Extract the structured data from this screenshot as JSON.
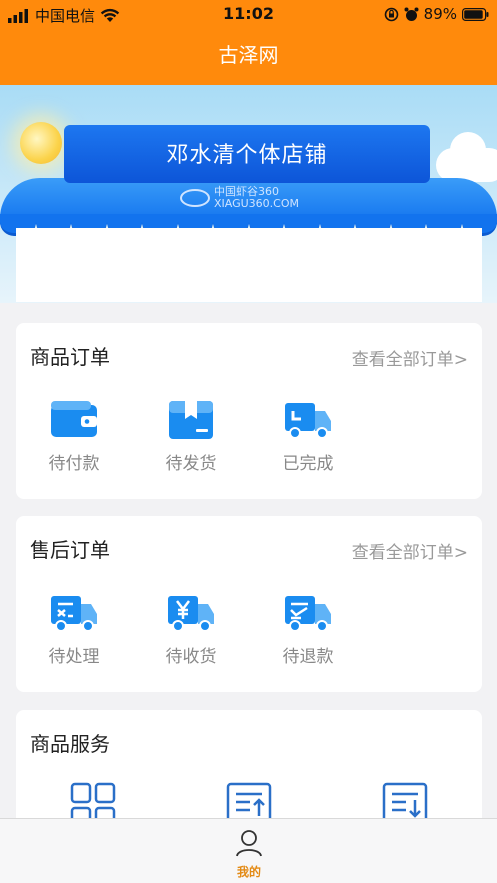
{
  "status_bar": {
    "carrier": "中国电信",
    "time": "11:02",
    "battery": "89%"
  },
  "nav": {
    "title": "古泽网"
  },
  "shop": {
    "name": "邓水清个体店铺",
    "awning_logo_cn": "中国虾谷360",
    "awning_logo_en": "XIAGU360.COM"
  },
  "orders": {
    "title": "商品订单",
    "view_all": "查看全部订单>",
    "items": [
      {
        "label": "待付款",
        "icon": "wallet-icon"
      },
      {
        "label": "待发货",
        "icon": "package-icon"
      },
      {
        "label": "已完成",
        "icon": "delivery-truck-icon"
      }
    ]
  },
  "aftersale": {
    "title": "售后订单",
    "view_all": "查看全部订单>",
    "items": [
      {
        "label": "待处理",
        "icon": "truck-pending-icon"
      },
      {
        "label": "待收货",
        "icon": "truck-yen-icon"
      },
      {
        "label": "待退款",
        "icon": "truck-refund-icon"
      }
    ]
  },
  "services": {
    "title": "商品服务",
    "items": [
      {
        "icon": "grid-icon"
      },
      {
        "icon": "upload-list-icon"
      },
      {
        "icon": "download-list-icon"
      }
    ]
  },
  "tabbar": {
    "me_label": "我的"
  },
  "colors": {
    "brand_orange": "#ff8a0c",
    "icon_blue": "#1a8cf0",
    "awning_blue": "#1273ee"
  }
}
